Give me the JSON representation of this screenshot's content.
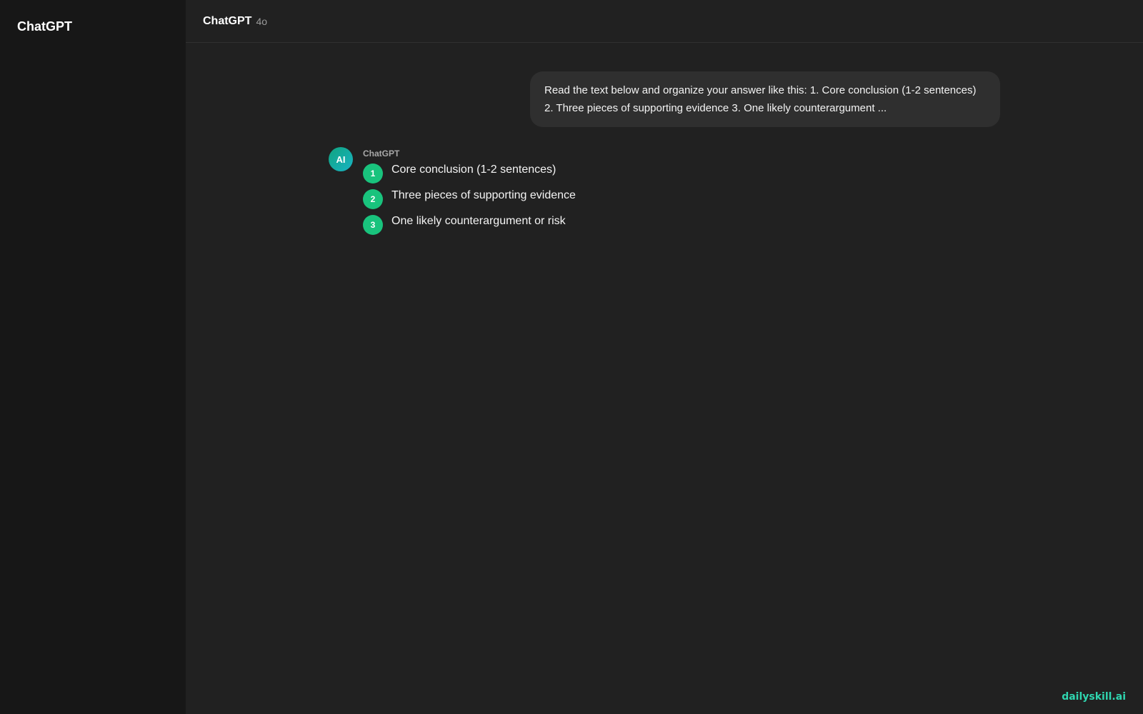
{
  "sidebar": {
    "title": "ChatGPT"
  },
  "header": {
    "title": "ChatGPT",
    "model": "4o"
  },
  "conversation": {
    "user_message": "Read the text below and organize your answer like this: 1. Core conclusion (1-2 sentences) 2. Three pieces of supporting evidence 3. One likely counterargument ...",
    "assistant": {
      "avatar_label": "AI",
      "name": "ChatGPT",
      "steps": [
        {
          "num": "1",
          "text": "Core conclusion (1-2 sentences)"
        },
        {
          "num": "2",
          "text": "Three pieces of supporting evidence"
        },
        {
          "num": "3",
          "text": "One likely counterargument or risk"
        }
      ]
    }
  },
  "watermark": "dailyskill.ai",
  "colors": {
    "background": "#212121",
    "sidebar": "#171717",
    "user_bubble": "#2f2f2f",
    "step_badge": "#19c37d",
    "watermark": "#2fd6b0"
  }
}
